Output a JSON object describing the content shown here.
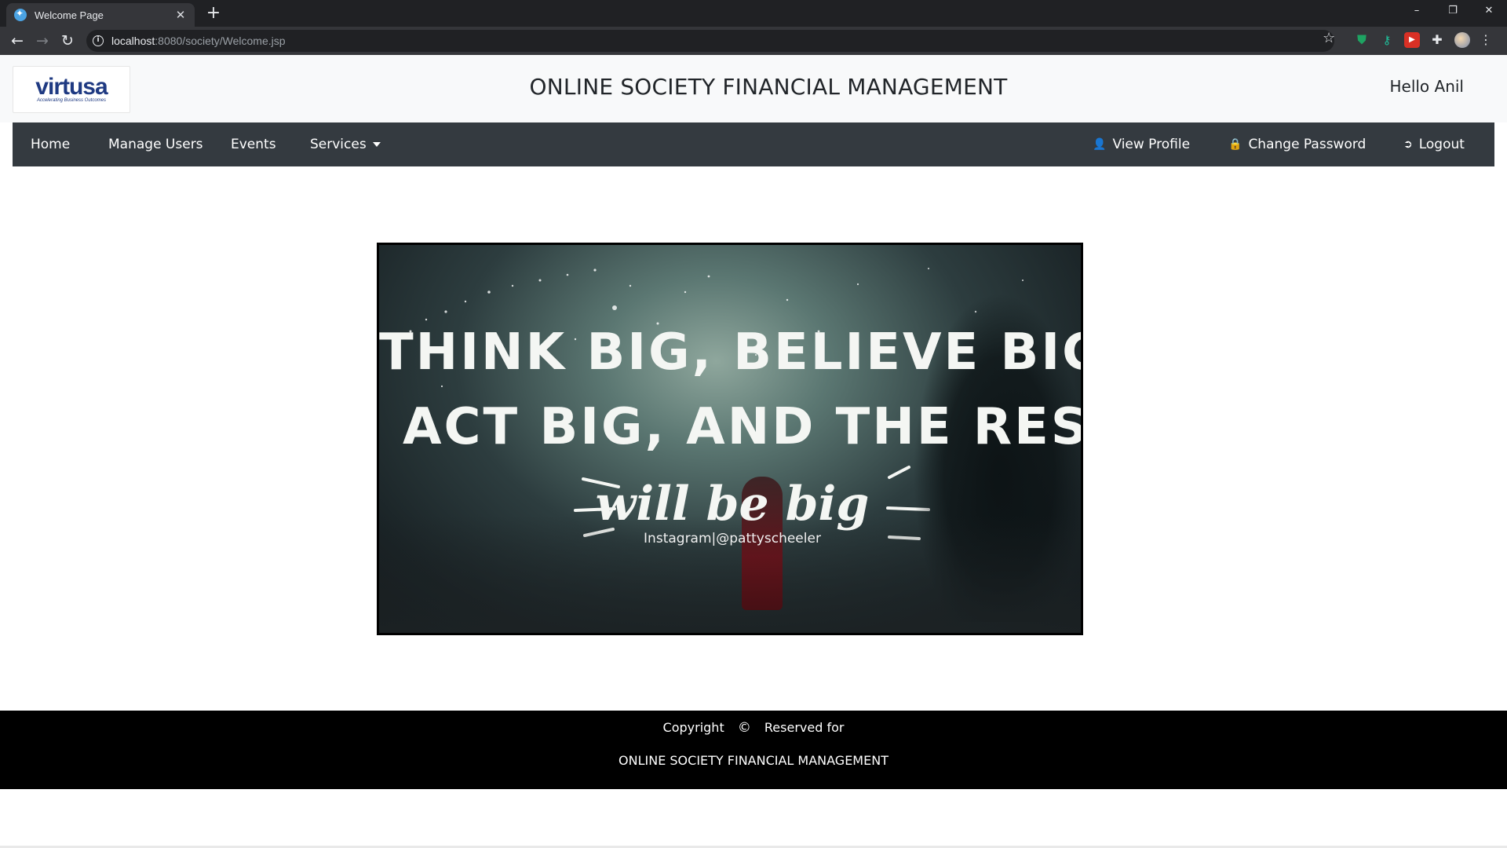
{
  "browser": {
    "tab": {
      "title": "Welcome Page"
    },
    "url_host": "localhost",
    "url_rest": ":8080/society/Welcome.jsp"
  },
  "header": {
    "logo_text": "virtusa",
    "logo_tagline": "Accelerating Business Outcomes",
    "title": "ONLINE SOCIETY FINANCIAL MANAGEMENT",
    "greeting": "Hello Anil"
  },
  "nav": {
    "home": "Home",
    "manage_users": "Manage Users",
    "events": "Events",
    "services": "Services",
    "view_profile": "View Profile",
    "change_password": "Change Password",
    "logout": "Logout"
  },
  "hero": {
    "line1": "THINK BIG, BELIEVE BIG,",
    "line2": "ACT BIG, AND THE RESULTS",
    "line3": "will be big",
    "credit": "Instagram|@pattyscheeler"
  },
  "footer": {
    "copyright": "Copyright",
    "reserved": "Reserved for",
    "name": "ONLINE SOCIETY FINANCIAL MANAGEMENT"
  },
  "icons": {
    "copyright_icon": "©",
    "user_icon": "user-icon",
    "lock_icon": "lock-icon",
    "logout_icon": "logout-icon"
  },
  "colors": {
    "navbar_bg": "#343a40",
    "header_bg": "#f8f9fa",
    "footer_bg": "#000000",
    "logo_blue": "#1f3a82"
  }
}
